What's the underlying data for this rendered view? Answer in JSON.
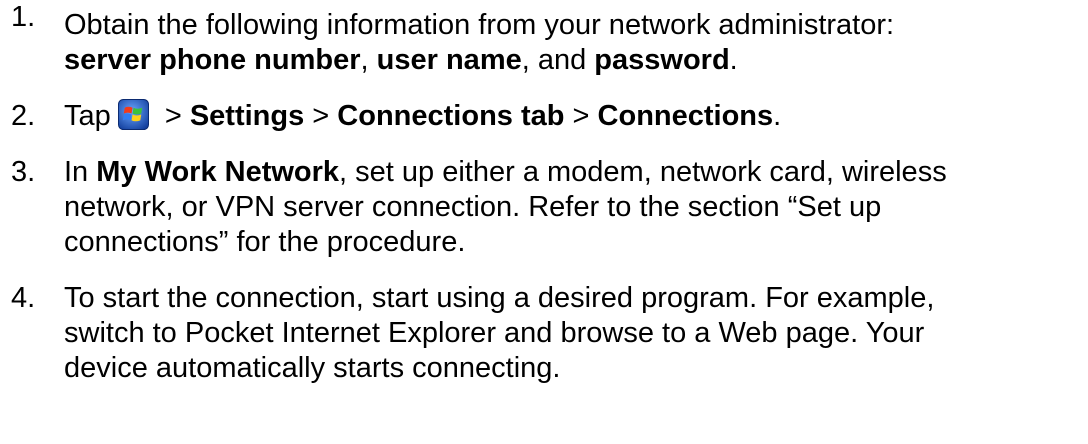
{
  "steps": [
    {
      "number": "1.",
      "line1": "Obtain the following information from your network administrator:",
      "line2": {
        "bold1": "server phone number",
        "sep1": ", ",
        "bold2": "user name",
        "sep2": ", and ",
        "bold3": "password",
        "end": "."
      }
    },
    {
      "number": "2.",
      "pre": "Tap",
      "icon": "windows-start-icon",
      "sep1": " > ",
      "bold1": "Settings",
      "sep2": " > ",
      "bold2": "Connections tab",
      "sep3": " > ",
      "bold3": "Connections",
      "end": "."
    },
    {
      "number": "3.",
      "pre": "In ",
      "bold1": "My Work Network",
      "line1_rest": ", set up either a modem, network card, wireless",
      "line2": "network, or VPN server connection. Refer to the section “Set up",
      "line3": "connections” for the procedure."
    },
    {
      "number": "4.",
      "line1": "To start the connection, start using a desired program. For example,",
      "line2": "switch to Pocket Internet Explorer and browse to a Web page. Your",
      "line3": "device automatically starts connecting."
    }
  ]
}
